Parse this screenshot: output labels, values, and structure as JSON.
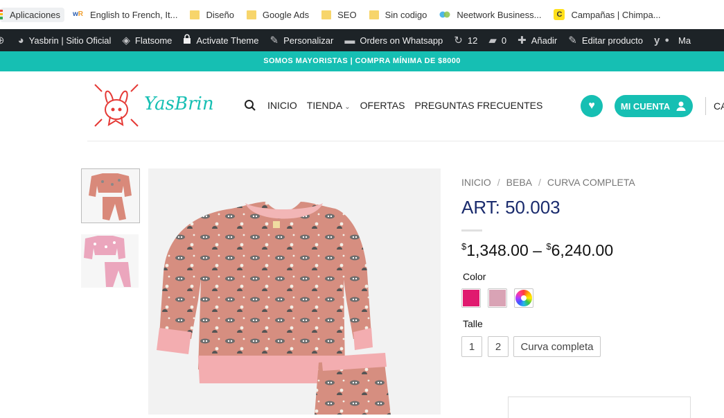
{
  "bookmarks": [
    {
      "label": "Aplicaciones",
      "icon": "apps-grid-icon"
    },
    {
      "label": "English to French, It...",
      "icon": "wordreference-icon"
    },
    {
      "label": "Diseño",
      "icon": "folder-icon"
    },
    {
      "label": "Google Ads",
      "icon": "folder-icon"
    },
    {
      "label": "SEO",
      "icon": "folder-icon"
    },
    {
      "label": "Sin codigo",
      "icon": "folder-icon"
    },
    {
      "label": "Neetwork Business...",
      "icon": "neetwork-icon"
    },
    {
      "label": "Campañas | Chimpa...",
      "icon": "mailchimp-icon"
    }
  ],
  "adminbar": {
    "items": [
      {
        "label": "Yasbrin | Sitio Oficial",
        "icon": "dashboard-icon"
      },
      {
        "label": "Flatsome",
        "icon": "flatsome-icon"
      },
      {
        "label": "Activate Theme",
        "icon": "lock-icon"
      },
      {
        "label": "Personalizar",
        "icon": "brush-icon"
      },
      {
        "label": "Orders on Whatsapp",
        "icon": "folder-icon"
      },
      {
        "label": "12",
        "icon": "updates-icon"
      },
      {
        "label": "0",
        "icon": "comments-icon"
      },
      {
        "label": "Añadir",
        "icon": "plus-icon"
      },
      {
        "label": "Editar producto",
        "icon": "pencil-icon"
      },
      {
        "label": "Ma",
        "icon": "yoast-icon"
      }
    ]
  },
  "promo": {
    "text": "SOMOS MAYORISTAS | COMPRA MÍNIMA DE $8000"
  },
  "header": {
    "logo_text": "YasBrin",
    "nav": [
      {
        "label": "INICIO"
      },
      {
        "label": "TIENDA",
        "dropdown": true
      },
      {
        "label": "OFERTAS"
      },
      {
        "label": "PREGUNTAS FRECUENTES"
      }
    ],
    "account_label": "MI CUENTA",
    "cart_label": "CA"
  },
  "product": {
    "breadcrumb": [
      "INICIO",
      "BEBA",
      "CURVA COMPLETA"
    ],
    "title": "ART: 50.003",
    "price_min_symbol": "$",
    "price_min": "1,348.00",
    "price_sep": "–",
    "price_max_symbol": "$",
    "price_max": "6,240.00",
    "color_label": "Color",
    "colors": [
      "#e01a6f",
      "#d9a3b5",
      "multicolor"
    ],
    "size_label": "Talle",
    "sizes": [
      "1",
      "2",
      "Curva completa"
    ]
  },
  "colors": {
    "accent": "#16bfb3",
    "title": "#1a2b6d",
    "adminbar": "#1d2327"
  }
}
